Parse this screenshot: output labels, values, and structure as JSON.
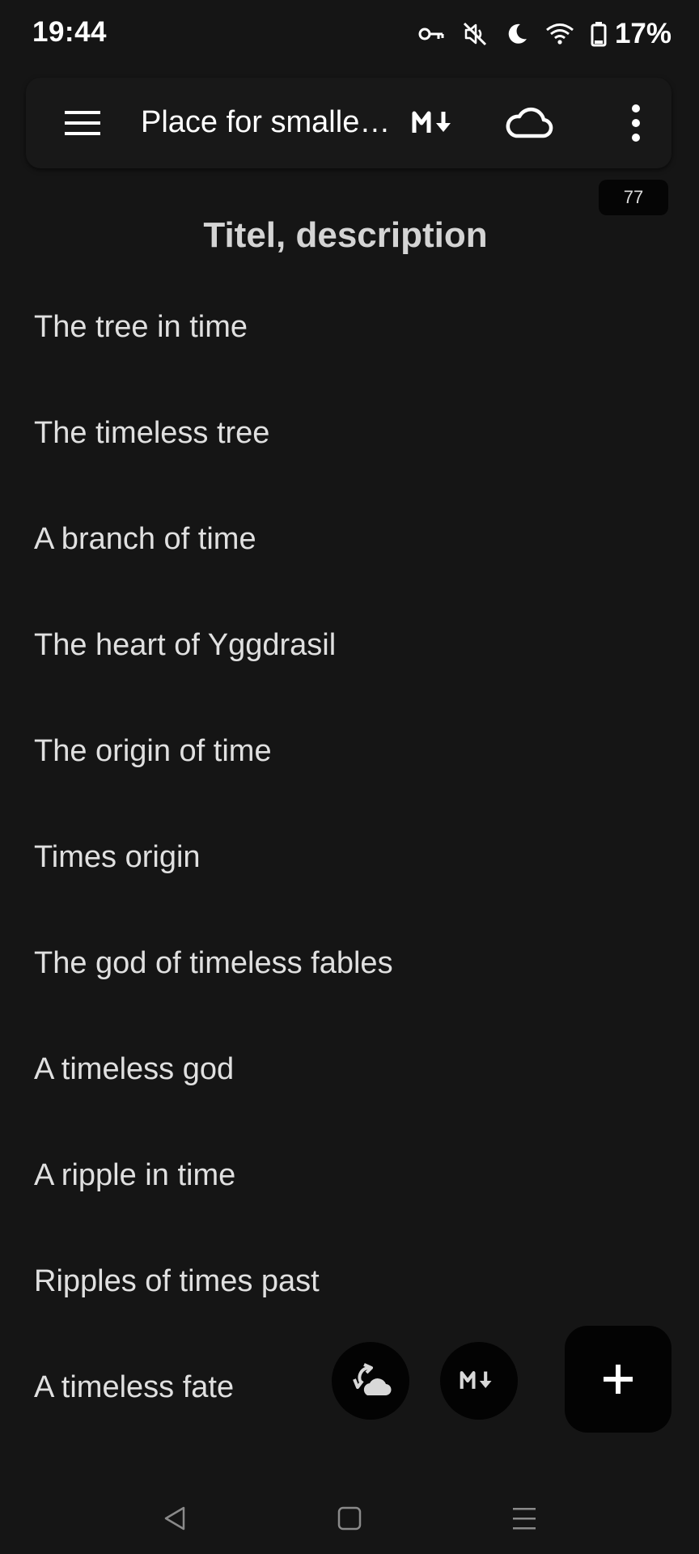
{
  "status_bar": {
    "time": "19:44",
    "battery": "17%",
    "icons": [
      "vpn-key-icon",
      "vibrate-off-icon",
      "do-not-disturb-moon-icon",
      "wifi-icon",
      "battery-icon"
    ]
  },
  "toolbar": {
    "title": "Place for smalle…",
    "icons": [
      "hamburger-menu-icon",
      "markdown-icon",
      "cloud-icon",
      "more-vertical-icon"
    ]
  },
  "count_badge": "77",
  "heading": "Titel, description",
  "lines": [
    "The tree in time",
    "The timeless tree",
    "A branch of time",
    "The heart of Yggdrasil",
    "The origin of time",
    "Times origin",
    "The god of timeless fables",
    "A timeless god",
    "A ripple in time",
    "Ripples of times past",
    "A timeless fate"
  ],
  "fabs": {
    "icons": [
      "cloud-sync-icon",
      "markdown-icon",
      "plus-icon"
    ]
  },
  "nav_bar": {
    "icons": [
      "back-triangle-icon",
      "home-square-icon",
      "recent-apps-icon"
    ]
  },
  "colors": {
    "background": "#151515",
    "toolbar": "#181818",
    "button": "#030303",
    "text": "#e0e0e0"
  }
}
